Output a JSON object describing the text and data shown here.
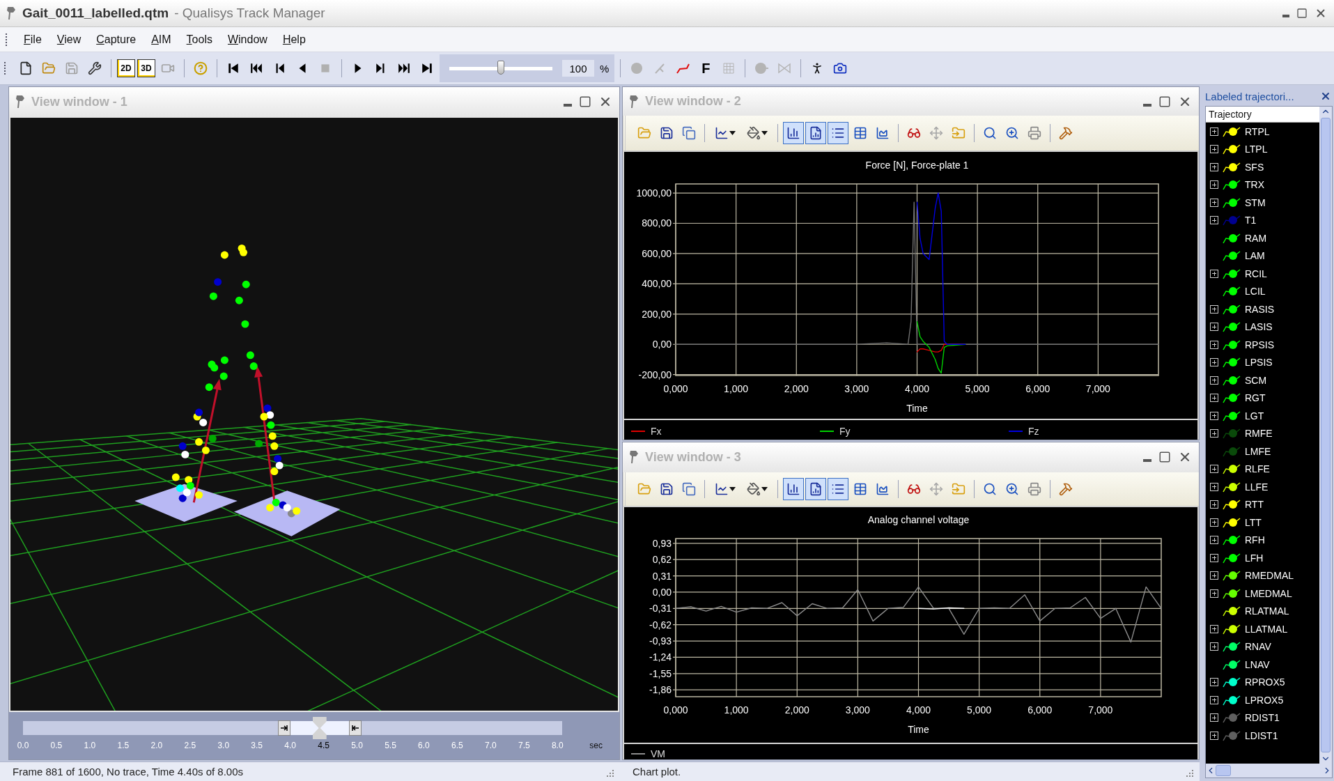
{
  "window": {
    "file_name": "Gait_0011_labelled.qtm",
    "app_name": "- Qualisys Track Manager"
  },
  "menu": [
    "File",
    "View",
    "Capture",
    "AIM",
    "Tools",
    "Window",
    "Help"
  ],
  "toolbar": {
    "view_2d": "2D",
    "view_3d": "3D",
    "speed": {
      "value": "100",
      "unit": "%",
      "level": 0.5
    },
    "force_button": "F"
  },
  "view_window_1": {
    "title": "View window - 1",
    "timeline": {
      "level": 0.55,
      "unit": "sec",
      "ticks": [
        {
          "label": "0.0",
          "selected": false
        },
        {
          "label": "0.5",
          "selected": false
        },
        {
          "label": "1.0",
          "selected": false
        },
        {
          "label": "1.5",
          "selected": false
        },
        {
          "label": "2.0",
          "selected": false
        },
        {
          "label": "2.5",
          "selected": false
        },
        {
          "label": "3.0",
          "selected": false
        },
        {
          "label": "3.5",
          "selected": false
        },
        {
          "label": "4.0",
          "selected": false
        },
        {
          "label": "4.5",
          "selected": true
        },
        {
          "label": "5.0",
          "selected": false
        },
        {
          "label": "5.5",
          "selected": false
        },
        {
          "label": "6.0",
          "selected": false
        },
        {
          "label": "6.5",
          "selected": false
        },
        {
          "label": "7.0",
          "selected": false
        },
        {
          "label": "7.5",
          "selected": false
        },
        {
          "label": "8.0",
          "selected": false
        }
      ]
    }
  },
  "view_window_2": {
    "title": "View window - 2",
    "tools": [
      {
        "pressed": false
      },
      {
        "pressed": false
      },
      {
        "pressed": false
      },
      {
        "pressed": false
      },
      {
        "pressed": false
      },
      {
        "pressed": true
      },
      {
        "pressed": true
      },
      {
        "pressed": true
      },
      {
        "pressed": false
      },
      {
        "pressed": false
      },
      {
        "pressed": false
      },
      {
        "pressed": false
      },
      {
        "pressed": false
      },
      {
        "pressed": false
      },
      {
        "pressed": false
      },
      {
        "pressed": false
      },
      {
        "pressed": false
      }
    ],
    "chart_data": {
      "type": "line",
      "title": "Force [N], Force-plate 1",
      "xlabel": "Time",
      "xlim": [
        0,
        8
      ],
      "ylim": [
        -206,
        1060
      ],
      "grid": true,
      "xticks": [
        {
          "value": 0,
          "label": "0,000"
        },
        {
          "value": 1,
          "label": "1,000"
        },
        {
          "value": 2,
          "label": "2,000"
        },
        {
          "value": 3,
          "label": "3,000"
        },
        {
          "value": 4,
          "label": "4,000"
        },
        {
          "value": 5,
          "label": "5,000"
        },
        {
          "value": 6,
          "label": "6,000"
        },
        {
          "value": 7,
          "label": "7,000"
        }
      ],
      "yticks": [
        {
          "value": 1000,
          "label": "1000,00"
        },
        {
          "value": 800,
          "label": "800,00"
        },
        {
          "value": 600,
          "label": "600,00"
        },
        {
          "value": 400,
          "label": "400,00"
        },
        {
          "value": 200,
          "label": "200,00"
        },
        {
          "value": 0,
          "label": "0,00"
        },
        {
          "value": -200,
          "label": "-200,00"
        }
      ],
      "x": [
        0,
        1,
        2,
        3,
        3.5,
        3.85,
        3.9,
        3.95,
        4.0,
        4.05,
        4.1,
        4.2,
        4.3,
        4.35,
        4.4,
        4.45,
        4.5,
        4.8,
        5,
        6,
        7,
        8
      ],
      "series": [
        {
          "color": "#707070",
          "values": [
            0,
            0,
            0,
            0,
            10,
            0,
            150,
            940,
            0,
            0,
            0,
            0,
            0,
            0,
            0,
            0,
            0,
            0,
            0,
            0,
            0,
            0
          ]
        },
        {
          "name": "Fx",
          "color": "#e00000",
          "values": [
            null,
            null,
            null,
            null,
            null,
            null,
            null,
            null,
            -50,
            -30,
            -30,
            -40,
            -50,
            -50,
            -40,
            0,
            0,
            0,
            null,
            null,
            null,
            null
          ]
        },
        {
          "name": "Fy",
          "color": "#00d000",
          "values": [
            null,
            null,
            null,
            null,
            null,
            null,
            null,
            null,
            150,
            50,
            20,
            -20,
            -100,
            -160,
            -190,
            -20,
            -10,
            0,
            null,
            null,
            null,
            null
          ]
        },
        {
          "name": "Fz",
          "color": "#0000e0",
          "values": [
            null,
            null,
            null,
            null,
            null,
            null,
            null,
            null,
            940,
            700,
            600,
            560,
            900,
            1000,
            880,
            20,
            0,
            0,
            null,
            null,
            null,
            null
          ]
        }
      ]
    }
  },
  "view_window_3": {
    "title": "View window - 3",
    "tools": [
      {
        "pressed": false
      },
      {
        "pressed": false
      },
      {
        "pressed": false
      },
      {
        "pressed": false
      },
      {
        "pressed": false
      },
      {
        "pressed": true
      },
      {
        "pressed": true
      },
      {
        "pressed": true
      },
      {
        "pressed": false
      },
      {
        "pressed": false
      },
      {
        "pressed": false
      },
      {
        "pressed": false
      },
      {
        "pressed": false
      },
      {
        "pressed": false
      },
      {
        "pressed": false
      },
      {
        "pressed": false
      },
      {
        "pressed": false
      }
    ],
    "chart_data": {
      "type": "line",
      "title": "Analog channel voltage",
      "xlabel": "Time",
      "xlim": [
        0,
        8
      ],
      "ylim": [
        -1.99,
        1.02
      ],
      "grid": true,
      "xticks": [
        {
          "value": 0,
          "label": "0,000"
        },
        {
          "value": 1,
          "label": "1,000"
        },
        {
          "value": 2,
          "label": "2,000"
        },
        {
          "value": 3,
          "label": "3,000"
        },
        {
          "value": 4,
          "label": "4,000"
        },
        {
          "value": 5,
          "label": "5,000"
        },
        {
          "value": 6,
          "label": "6,000"
        },
        {
          "value": 7,
          "label": "7,000"
        }
      ],
      "yticks": [
        {
          "value": 0.93,
          "label": "0,93"
        },
        {
          "value": 0.62,
          "label": "0,62"
        },
        {
          "value": 0.31,
          "label": "0,31"
        },
        {
          "value": 0,
          "label": "0,00"
        },
        {
          "value": -0.31,
          "label": "-0,31"
        },
        {
          "value": -0.62,
          "label": "-0,62"
        },
        {
          "value": -0.93,
          "label": "-0,93"
        },
        {
          "value": -1.24,
          "label": "-1,24"
        },
        {
          "value": -1.55,
          "label": "-1,55"
        },
        {
          "value": -1.86,
          "label": "-1,86"
        }
      ],
      "x": [
        0,
        0.25,
        0.5,
        0.75,
        1,
        1.25,
        1.5,
        1.75,
        2,
        2.25,
        2.5,
        2.75,
        3,
        3.25,
        3.5,
        3.75,
        4,
        4.25,
        4.5,
        4.75,
        5,
        5.25,
        5.5,
        5.75,
        6,
        6.25,
        6.5,
        6.75,
        7,
        7.25,
        7.5,
        7.75,
        8
      ],
      "series": [
        {
          "name": "VM",
          "color": "#8c8c8c",
          "values": [
            -0.31,
            -0.28,
            -0.36,
            -0.27,
            -0.38,
            -0.3,
            -0.31,
            -0.2,
            -0.45,
            -0.22,
            -0.31,
            -0.3,
            0.05,
            -0.55,
            -0.31,
            -0.29,
            0.1,
            -0.31,
            -0.31,
            -0.8,
            -0.31,
            -0.3,
            -0.31,
            -0.05,
            -0.55,
            -0.31,
            -0.3,
            -0.1,
            -0.5,
            -0.31,
            -0.95,
            0.1,
            -0.31
          ]
        },
        {
          "color": "#ffffff",
          "values": [
            null,
            null,
            null,
            null,
            null,
            null,
            null,
            null,
            null,
            null,
            null,
            null,
            null,
            null,
            null,
            null,
            -0.31,
            -0.32,
            -0.3,
            -0.31,
            null,
            null,
            null,
            null,
            null,
            null,
            null,
            null,
            null,
            null,
            null,
            null,
            null
          ]
        }
      ]
    }
  },
  "status_left": "Frame 881 of 1600, No trace, Time 4.40s of 8.00s",
  "status_right": "Chart plot.",
  "trajectories": {
    "title": "Labeled trajectori...",
    "column": "Trajectory",
    "items": [
      {
        "name": "RTPL",
        "color": "#ffff00",
        "expandable": true
      },
      {
        "name": "LTPL",
        "color": "#ffff00",
        "expandable": true
      },
      {
        "name": "SFS",
        "color": "#ffff00",
        "expandable": true
      },
      {
        "name": "TRX",
        "color": "#00ff00",
        "expandable": true
      },
      {
        "name": "STM",
        "color": "#00ff00",
        "expandable": true
      },
      {
        "name": "T1",
        "color": "#000090",
        "expandable": true
      },
      {
        "name": "RAM",
        "color": "#00ff00",
        "expandable": false
      },
      {
        "name": "LAM",
        "color": "#00ff00",
        "expandable": false
      },
      {
        "name": "RCIL",
        "color": "#00ff00",
        "expandable": true
      },
      {
        "name": "LCIL",
        "color": "#00ff00",
        "expandable": false
      },
      {
        "name": "RASIS",
        "color": "#00ff00",
        "expandable": true
      },
      {
        "name": "LASIS",
        "color": "#00ff00",
        "expandable": true
      },
      {
        "name": "RPSIS",
        "color": "#00ff00",
        "expandable": true
      },
      {
        "name": "LPSIS",
        "color": "#00ff00",
        "expandable": true
      },
      {
        "name": "SCM",
        "color": "#00ff00",
        "expandable": true
      },
      {
        "name": "RGT",
        "color": "#00ff00",
        "expandable": true
      },
      {
        "name": "LGT",
        "color": "#00ff00",
        "expandable": true
      },
      {
        "name": "RMFE",
        "color": "#0a4a0a",
        "expandable": true
      },
      {
        "name": "LMFE",
        "color": "#0a4a0a",
        "expandable": false
      },
      {
        "name": "RLFE",
        "color": "#ccff00",
        "expandable": true
      },
      {
        "name": "LLFE",
        "color": "#ccff00",
        "expandable": true
      },
      {
        "name": "RTT",
        "color": "#ffff00",
        "expandable": true
      },
      {
        "name": "LTT",
        "color": "#ffff00",
        "expandable": true
      },
      {
        "name": "RFH",
        "color": "#00ff00",
        "expandable": true
      },
      {
        "name": "LFH",
        "color": "#00ff00",
        "expandable": true
      },
      {
        "name": "RMEDMAL",
        "color": "#66ff00",
        "expandable": true
      },
      {
        "name": "LMEDMAL",
        "color": "#66ff00",
        "expandable": true
      },
      {
        "name": "RLATMAL",
        "color": "#ccff00",
        "expandable": false
      },
      {
        "name": "LLATMAL",
        "color": "#ccff00",
        "expandable": true
      },
      {
        "name": "RNAV",
        "color": "#00ff66",
        "expandable": true
      },
      {
        "name": "LNAV",
        "color": "#00ff66",
        "expandable": false
      },
      {
        "name": "RPROX5",
        "color": "#00ffcc",
        "expandable": true
      },
      {
        "name": "LPROX5",
        "color": "#00ffcc",
        "expandable": true
      },
      {
        "name": "RDIST1",
        "color": "#606060",
        "expandable": true
      },
      {
        "name": "LDIST1",
        "color": "#606060",
        "expandable": true
      }
    ]
  }
}
